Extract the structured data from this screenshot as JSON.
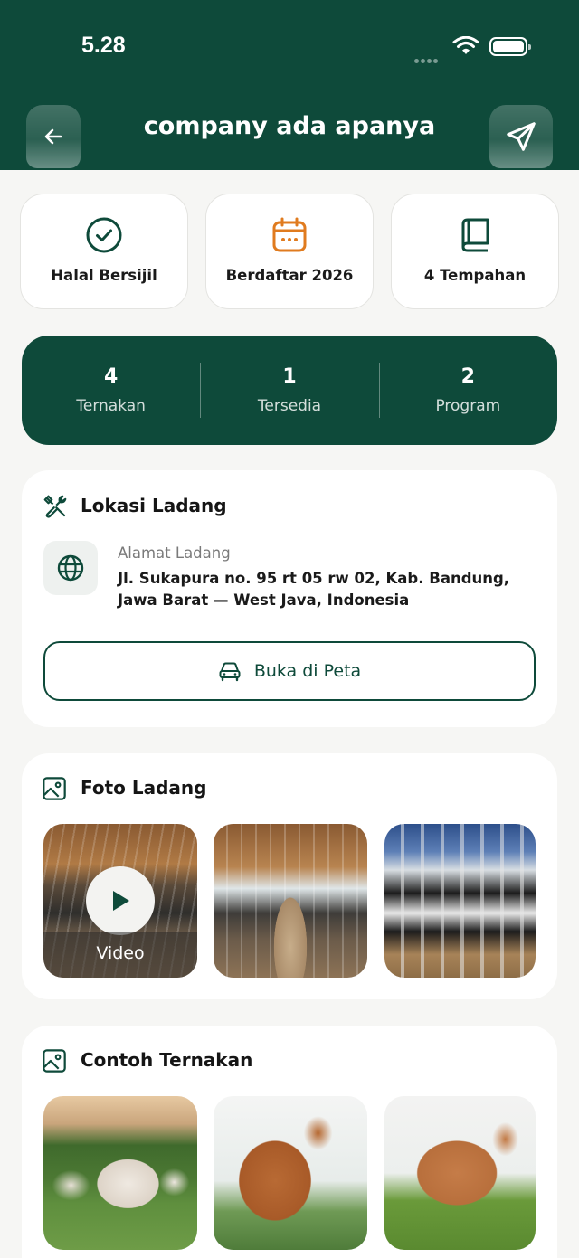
{
  "status_bar": {
    "time": "5.28"
  },
  "header": {
    "title": "company ada apanya",
    "back_icon": "arrow-left-icon",
    "send_icon": "paper-plane-icon"
  },
  "badges": [
    {
      "label": "Halal Bersijil",
      "icon": "check-circle-icon",
      "color": "#0e4a3a"
    },
    {
      "label": "Berdaftar 2026",
      "icon": "calendar-icon",
      "color": "#e07b1f"
    },
    {
      "label": "4 Tempahan",
      "icon": "book-icon",
      "color": "#0e4a3a"
    }
  ],
  "stats": [
    {
      "value": "4",
      "label": "Ternakan"
    },
    {
      "value": "1",
      "label": "Tersedia"
    },
    {
      "value": "2",
      "label": "Program"
    }
  ],
  "location": {
    "title": "Lokasi Ladang",
    "address_label": "Alamat Ladang",
    "address": "Jl. Sukapura no. 95 rt 05 rw 02, Kab. Bandung, Jawa Barat — West Java, Indonesia",
    "map_button": "Buka di Peta"
  },
  "farm_photos": {
    "title": "Foto Ladang",
    "video_label": "Video"
  },
  "livestock": {
    "title": "Contoh Ternakan"
  },
  "colors": {
    "primary": "#0e4a3a",
    "accent": "#e07b1f",
    "background": "#f6f6f4"
  }
}
